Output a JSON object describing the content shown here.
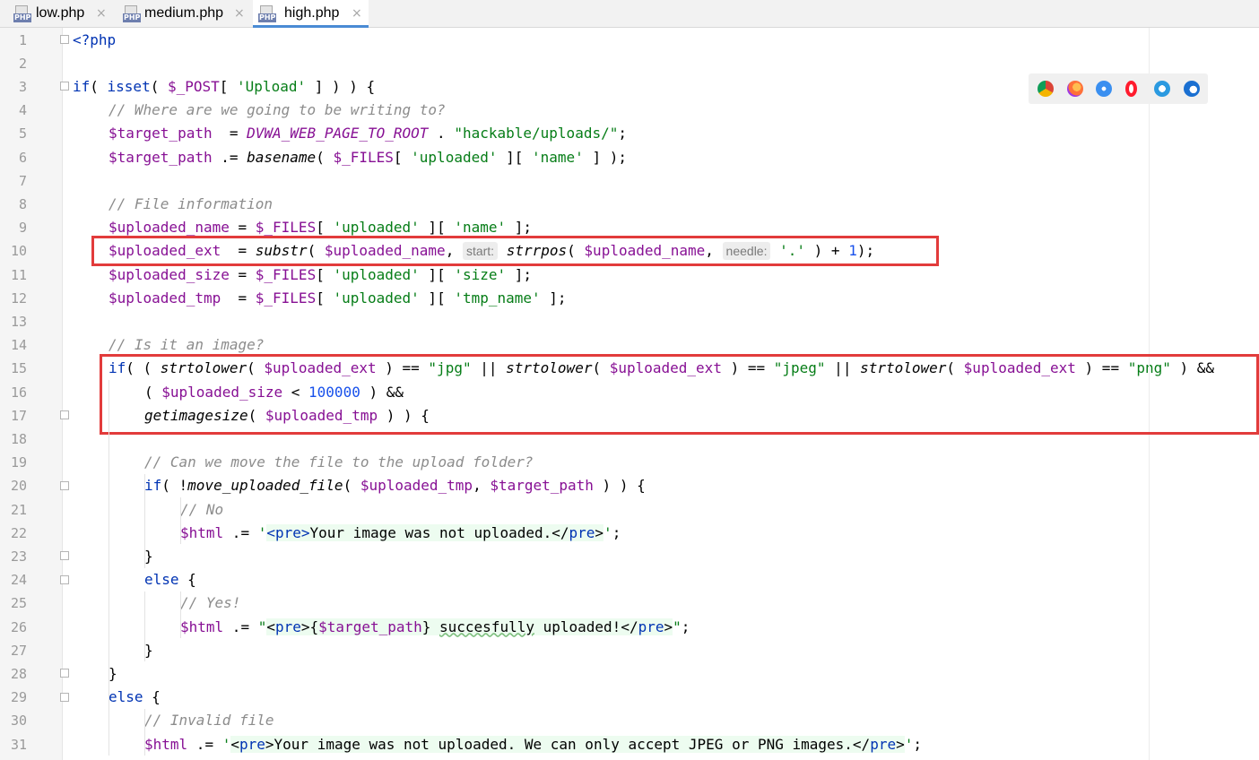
{
  "tabs": [
    {
      "label": "low.php",
      "icon": "php-file-icon",
      "active": false
    },
    {
      "label": "medium.php",
      "icon": "php-file-icon",
      "active": false
    },
    {
      "label": "high.php",
      "icon": "php-file-icon",
      "active": true
    }
  ],
  "tab_icon_text": "PHP",
  "tab_close_glyph": "×",
  "browser_icons": [
    "chrome-icon",
    "firefox-icon",
    "safari-icon",
    "opera-icon",
    "ie-icon",
    "edge-icon"
  ],
  "line_numbers": [
    "1",
    "2",
    "3",
    "4",
    "5",
    "6",
    "7",
    "8",
    "9",
    "10",
    "11",
    "12",
    "13",
    "14",
    "15",
    "16",
    "17",
    "18",
    "19",
    "20",
    "21",
    "22",
    "23",
    "24",
    "25",
    "26",
    "27",
    "28",
    "29",
    "30",
    "31"
  ],
  "code_lines": [
    [
      [
        "tag",
        "<?php"
      ]
    ],
    [],
    [
      [
        "kw",
        "if"
      ],
      [
        "plain",
        "( "
      ],
      [
        "fn",
        "isset"
      ],
      [
        "plain",
        "( "
      ],
      [
        "var",
        "$_POST"
      ],
      [
        "plain",
        "[ "
      ],
      [
        "str",
        "'Upload'"
      ],
      [
        "plain",
        " ] ) ) {"
      ]
    ],
    [
      [
        "cmt",
        "// Where are we going to be writing to?"
      ]
    ],
    [
      [
        "var",
        "$target_path"
      ],
      [
        "plain",
        "  = "
      ],
      [
        "const",
        "DVWA_WEB_PAGE_TO_ROOT"
      ],
      [
        "plain",
        " . "
      ],
      [
        "str",
        "\"hackable/uploads/\""
      ],
      [
        "plain",
        ";"
      ]
    ],
    [
      [
        "var",
        "$target_path"
      ],
      [
        "plain",
        " .= "
      ],
      [
        "ifn",
        "basename"
      ],
      [
        "plain",
        "( "
      ],
      [
        "var",
        "$_FILES"
      ],
      [
        "plain",
        "[ "
      ],
      [
        "str",
        "'uploaded'"
      ],
      [
        "plain",
        " ][ "
      ],
      [
        "str",
        "'name'"
      ],
      [
        "plain",
        " ] );"
      ]
    ],
    [],
    [
      [
        "cmt",
        "// File information"
      ]
    ],
    [
      [
        "var",
        "$uploaded_name"
      ],
      [
        "plain",
        " = "
      ],
      [
        "var",
        "$_FILES"
      ],
      [
        "plain",
        "[ "
      ],
      [
        "str",
        "'uploaded'"
      ],
      [
        "plain",
        " ][ "
      ],
      [
        "str",
        "'name'"
      ],
      [
        "plain",
        " ];"
      ]
    ],
    [
      [
        "var",
        "$uploaded_ext"
      ],
      [
        "plain",
        "  = "
      ],
      [
        "ifn",
        "substr"
      ],
      [
        "plain",
        "( "
      ],
      [
        "var",
        "$uploaded_name"
      ],
      [
        "plain",
        ", "
      ],
      [
        "hint",
        "start:"
      ],
      [
        "plain",
        " "
      ],
      [
        "ifn",
        "strrpos"
      ],
      [
        "plain",
        "( "
      ],
      [
        "var",
        "$uploaded_name"
      ],
      [
        "plain",
        ", "
      ],
      [
        "hint",
        "needle:"
      ],
      [
        "plain",
        " "
      ],
      [
        "str",
        "'.'"
      ],
      [
        "plain",
        " ) + "
      ],
      [
        "num",
        "1"
      ],
      [
        "plain",
        ");"
      ]
    ],
    [
      [
        "var",
        "$uploaded_size"
      ],
      [
        "plain",
        " = "
      ],
      [
        "var",
        "$_FILES"
      ],
      [
        "plain",
        "[ "
      ],
      [
        "str",
        "'uploaded'"
      ],
      [
        "plain",
        " ][ "
      ],
      [
        "str",
        "'size'"
      ],
      [
        "plain",
        " ];"
      ]
    ],
    [
      [
        "var",
        "$uploaded_tmp"
      ],
      [
        "plain",
        "  = "
      ],
      [
        "var",
        "$_FILES"
      ],
      [
        "plain",
        "[ "
      ],
      [
        "str",
        "'uploaded'"
      ],
      [
        "plain",
        " ][ "
      ],
      [
        "str",
        "'tmp_name'"
      ],
      [
        "plain",
        " ];"
      ]
    ],
    [],
    [
      [
        "cmt",
        "// Is it an image?"
      ]
    ],
    [
      [
        "kw",
        "if"
      ],
      [
        "plain",
        "( ( "
      ],
      [
        "ifn",
        "strtolower"
      ],
      [
        "plain",
        "( "
      ],
      [
        "var",
        "$uploaded_ext"
      ],
      [
        "plain",
        " ) == "
      ],
      [
        "str",
        "\"jpg\""
      ],
      [
        "plain",
        " || "
      ],
      [
        "ifn",
        "strtolower"
      ],
      [
        "plain",
        "( "
      ],
      [
        "var",
        "$uploaded_ext"
      ],
      [
        "plain",
        " ) == "
      ],
      [
        "str",
        "\"jpeg\""
      ],
      [
        "plain",
        " || "
      ],
      [
        "ifn",
        "strtolower"
      ],
      [
        "plain",
        "( "
      ],
      [
        "var",
        "$uploaded_ext"
      ],
      [
        "plain",
        " ) == "
      ],
      [
        "str",
        "\"png\""
      ],
      [
        "plain",
        " ) &&"
      ]
    ],
    [
      [
        "plain",
        "( "
      ],
      [
        "var",
        "$uploaded_size"
      ],
      [
        "plain",
        " < "
      ],
      [
        "num",
        "100000"
      ],
      [
        "plain",
        " ) &&"
      ]
    ],
    [
      [
        "ifn",
        "getimagesize"
      ],
      [
        "plain",
        "( "
      ],
      [
        "var",
        "$uploaded_tmp"
      ],
      [
        "plain",
        " ) ) {"
      ]
    ],
    [],
    [
      [
        "cmt",
        "// Can we move the file to the upload folder?"
      ]
    ],
    [
      [
        "kw",
        "if"
      ],
      [
        "plain",
        "( !"
      ],
      [
        "ifn",
        "move_uploaded_file"
      ],
      [
        "plain",
        "( "
      ],
      [
        "var",
        "$uploaded_tmp"
      ],
      [
        "plain",
        ", "
      ],
      [
        "var",
        "$target_path"
      ],
      [
        "plain",
        " ) ) {"
      ]
    ],
    [
      [
        "cmt",
        "// No"
      ]
    ],
    [
      [
        "var",
        "$html"
      ],
      [
        "plain",
        " .= "
      ],
      [
        "str",
        "'"
      ],
      [
        "inj-tag",
        "<pre>"
      ],
      [
        "inj",
        "Your image was not uploaded.</"
      ],
      [
        "inj-tag",
        "pre"
      ],
      [
        "inj",
        ">"
      ],
      [
        "str",
        "'"
      ],
      [
        "plain",
        ";"
      ]
    ],
    [
      [
        "plain",
        "}"
      ]
    ],
    [
      [
        "kw",
        "else"
      ],
      [
        "plain",
        " {"
      ]
    ],
    [
      [
        "cmt",
        "// Yes!"
      ]
    ],
    [
      [
        "var",
        "$html"
      ],
      [
        "plain",
        " .= "
      ],
      [
        "str",
        "\""
      ],
      [
        "inj",
        "<"
      ],
      [
        "inj-tag",
        "pre"
      ],
      [
        "inj",
        ">{"
      ],
      [
        "inj-var",
        "$target_path"
      ],
      [
        "inj",
        "} "
      ],
      [
        "typo",
        "succesfully"
      ],
      [
        "inj",
        " uploaded!</"
      ],
      [
        "inj-tag",
        "pre"
      ],
      [
        "inj",
        ">"
      ],
      [
        "str",
        "\""
      ],
      [
        "plain",
        ";"
      ]
    ],
    [
      [
        "plain",
        "}"
      ]
    ],
    [
      [
        "plain",
        "}"
      ]
    ],
    [
      [
        "kw",
        "else"
      ],
      [
        "plain",
        " {"
      ]
    ],
    [
      [
        "cmt",
        "// Invalid file"
      ]
    ],
    [
      [
        "var",
        "$html"
      ],
      [
        "plain",
        " .= "
      ],
      [
        "str",
        "'"
      ],
      [
        "inj",
        "<"
      ],
      [
        "inj-tag",
        "pre"
      ],
      [
        "inj",
        ">Your image was not uploaded. We can only accept JPEG or PNG images.</"
      ],
      [
        "inj-tag",
        "pre"
      ],
      [
        "inj",
        ">"
      ],
      [
        "str",
        "'"
      ],
      [
        "plain",
        ";"
      ]
    ]
  ]
}
